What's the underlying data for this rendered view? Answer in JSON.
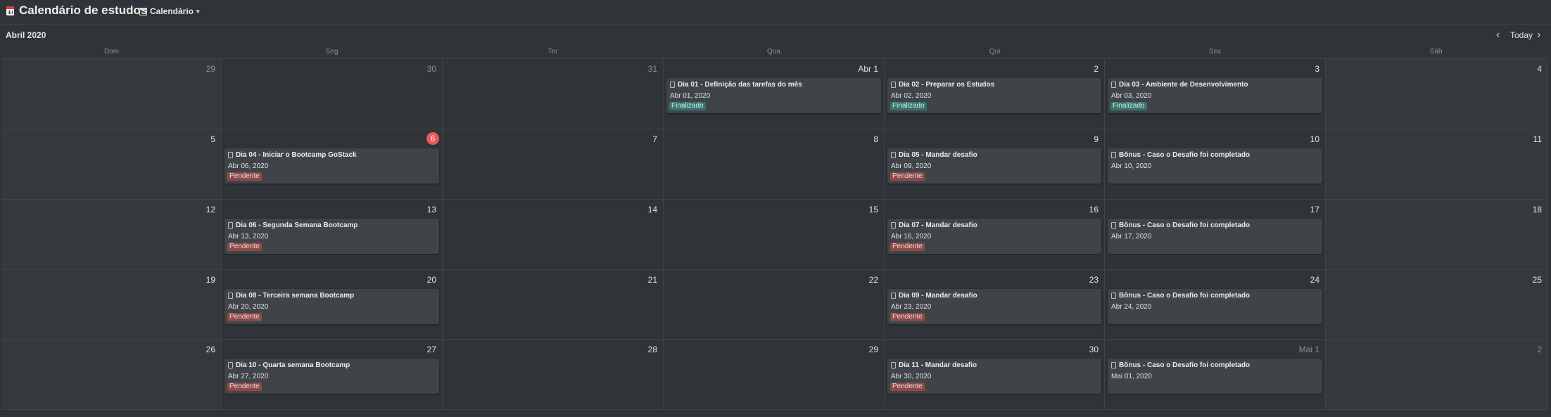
{
  "header": {
    "title": "Calendário de estudos",
    "view_label": "Calendário"
  },
  "calendar": {
    "month_label": "Abril 2020",
    "today_label": "Today"
  },
  "weekdays": [
    "Dom",
    "Seg",
    "Ter",
    "Qua",
    "Qui",
    "Sex",
    "Sáb"
  ],
  "days": [
    [
      "29",
      "30",
      "31",
      "Abr 1",
      "2",
      "3",
      "4"
    ],
    [
      "5",
      "6",
      "7",
      "8",
      "9",
      "10",
      "11"
    ],
    [
      "12",
      "13",
      "14",
      "15",
      "16",
      "17",
      "18"
    ],
    [
      "19",
      "20",
      "21",
      "22",
      "23",
      "24",
      "25"
    ],
    [
      "26",
      "27",
      "28",
      "29",
      "30",
      "Mai 1",
      "2"
    ]
  ],
  "events": [
    {
      "title": "Dia 01 - Definição das tarefas do mês",
      "date": "Abr 01, 2020",
      "status": "Finalizado"
    },
    {
      "title": "Dia 02 - Preparar os Estudos",
      "date": "Abr 02, 2020",
      "status": "Finalizado"
    },
    {
      "title": "Dia 03 - Ambiente de Desenvolvimento",
      "date": "Abr 03, 2020",
      "status": "Finalizado"
    },
    {
      "title": "Dia 04 - Iniciar o Bootcamp GoStack",
      "date": "Abr 06, 2020",
      "status": "Pendente"
    },
    {
      "title": "Dia 05 - Mandar desafio",
      "date": "Abr 09, 2020",
      "status": "Pendente"
    },
    {
      "title": "Bônus - Caso o Desafio foi completado",
      "date": "Abr 10, 2020",
      "status": ""
    },
    {
      "title": "Dia 06 - Segunda Semana Bootcamp",
      "date": "Abr 13, 2020",
      "status": "Pendente"
    },
    {
      "title": "Dia 07 - Mandar desafio",
      "date": "Abr 16, 2020",
      "status": "Pendente"
    },
    {
      "title": "Bônus - Caso o Desafio foi completado",
      "date": "Abr 17, 2020",
      "status": ""
    },
    {
      "title": "Dia 08 - Terceira semana Bootcamp",
      "date": "Abr 20, 2020",
      "status": "Pendente"
    },
    {
      "title": "Dia 09 - Mandar desafio",
      "date": "Abr 23, 2020",
      "status": "Pendente"
    },
    {
      "title": "Bônus - Caso o Desafio foi completado",
      "date": "Abr 24, 2020",
      "status": ""
    },
    {
      "title": "Dia 10 - Quarta semana Bootcamp",
      "date": "Abr 27, 2020",
      "status": "Pendente"
    },
    {
      "title": "Dia 11 - Mandar desafio",
      "date": "Abr 30, 2020",
      "status": "Pendente"
    },
    {
      "title": "Bônus - Caso o Desafio foi completado",
      "date": "Mai 01, 2020",
      "status": ""
    }
  ],
  "colors": {
    "background": "#2f3437",
    "today": "#eb5757",
    "status_done": "#35736b",
    "status_pending": "#8b4a4a"
  },
  "icons": {
    "page": "calendar-page-icon",
    "view": "calendar-icon",
    "card": "document-icon",
    "prev": "chevron-left-icon",
    "next": "chevron-right-icon"
  }
}
